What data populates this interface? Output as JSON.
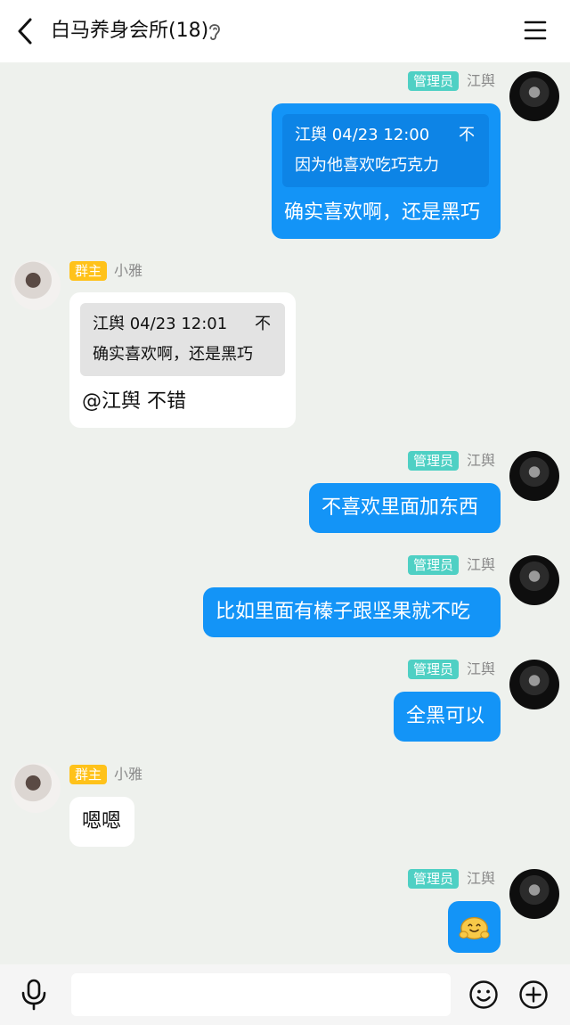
{
  "header": {
    "title": "白马养身会所(18)"
  },
  "messages": [
    {
      "sender": "江舆",
      "role": "管理员",
      "quote": {
        "meta": "江舆 04/23 12:00",
        "text": "因为他喜欢吃巧克力"
      },
      "text": "确实喜欢啊，还是黑巧"
    },
    {
      "sender": "小雅",
      "role": "群主",
      "quote": {
        "meta": "江舆 04/23 12:01",
        "text": "确实喜欢啊，还是黑巧"
      },
      "text": "@江舆 不错"
    },
    {
      "sender": "江舆",
      "role": "管理员",
      "text": "不喜欢里面加东西"
    },
    {
      "sender": "江舆",
      "role": "管理员",
      "text": "比如里面有榛子跟坚果就不吃"
    },
    {
      "sender": "江舆",
      "role": "管理员",
      "text": "全黑可以"
    },
    {
      "sender": "小雅",
      "role": "群主",
      "text": "嗯嗯"
    },
    {
      "sender": "江舆",
      "role": "管理员",
      "sticker": "smiling-face-sticker"
    }
  ],
  "quote_icon": "不",
  "input": {
    "placeholder": ""
  },
  "icons": {
    "back": "chevron-left-icon",
    "ear": "ear-icon",
    "menu": "hamburger-menu-icon",
    "mic": "microphone-icon",
    "emoji": "smiley-icon",
    "plus": "plus-circle-icon"
  },
  "colors": {
    "bubble_out": "#1394f7",
    "admin_tag": "#4fd0c4",
    "owner_tag": "#ffc21a",
    "background": "#eef1ed"
  }
}
